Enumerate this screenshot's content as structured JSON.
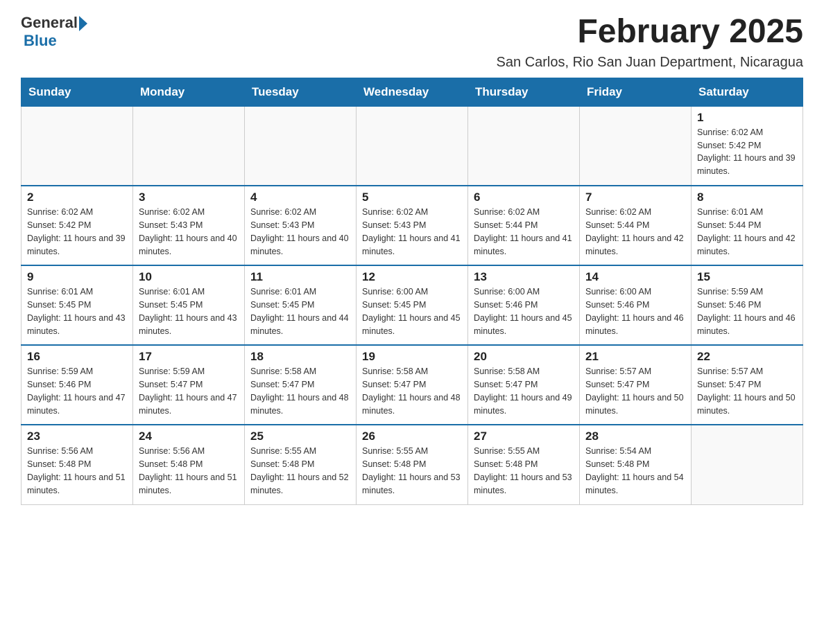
{
  "header": {
    "logo_general": "General",
    "logo_blue": "Blue",
    "month_title": "February 2025",
    "location": "San Carlos, Rio San Juan Department, Nicaragua"
  },
  "days_of_week": [
    "Sunday",
    "Monday",
    "Tuesday",
    "Wednesday",
    "Thursday",
    "Friday",
    "Saturday"
  ],
  "weeks": [
    [
      {
        "day": "",
        "info": ""
      },
      {
        "day": "",
        "info": ""
      },
      {
        "day": "",
        "info": ""
      },
      {
        "day": "",
        "info": ""
      },
      {
        "day": "",
        "info": ""
      },
      {
        "day": "",
        "info": ""
      },
      {
        "day": "1",
        "info": "Sunrise: 6:02 AM\nSunset: 5:42 PM\nDaylight: 11 hours and 39 minutes."
      }
    ],
    [
      {
        "day": "2",
        "info": "Sunrise: 6:02 AM\nSunset: 5:42 PM\nDaylight: 11 hours and 39 minutes."
      },
      {
        "day": "3",
        "info": "Sunrise: 6:02 AM\nSunset: 5:43 PM\nDaylight: 11 hours and 40 minutes."
      },
      {
        "day": "4",
        "info": "Sunrise: 6:02 AM\nSunset: 5:43 PM\nDaylight: 11 hours and 40 minutes."
      },
      {
        "day": "5",
        "info": "Sunrise: 6:02 AM\nSunset: 5:43 PM\nDaylight: 11 hours and 41 minutes."
      },
      {
        "day": "6",
        "info": "Sunrise: 6:02 AM\nSunset: 5:44 PM\nDaylight: 11 hours and 41 minutes."
      },
      {
        "day": "7",
        "info": "Sunrise: 6:02 AM\nSunset: 5:44 PM\nDaylight: 11 hours and 42 minutes."
      },
      {
        "day": "8",
        "info": "Sunrise: 6:01 AM\nSunset: 5:44 PM\nDaylight: 11 hours and 42 minutes."
      }
    ],
    [
      {
        "day": "9",
        "info": "Sunrise: 6:01 AM\nSunset: 5:45 PM\nDaylight: 11 hours and 43 minutes."
      },
      {
        "day": "10",
        "info": "Sunrise: 6:01 AM\nSunset: 5:45 PM\nDaylight: 11 hours and 43 minutes."
      },
      {
        "day": "11",
        "info": "Sunrise: 6:01 AM\nSunset: 5:45 PM\nDaylight: 11 hours and 44 minutes."
      },
      {
        "day": "12",
        "info": "Sunrise: 6:00 AM\nSunset: 5:45 PM\nDaylight: 11 hours and 45 minutes."
      },
      {
        "day": "13",
        "info": "Sunrise: 6:00 AM\nSunset: 5:46 PM\nDaylight: 11 hours and 45 minutes."
      },
      {
        "day": "14",
        "info": "Sunrise: 6:00 AM\nSunset: 5:46 PM\nDaylight: 11 hours and 46 minutes."
      },
      {
        "day": "15",
        "info": "Sunrise: 5:59 AM\nSunset: 5:46 PM\nDaylight: 11 hours and 46 minutes."
      }
    ],
    [
      {
        "day": "16",
        "info": "Sunrise: 5:59 AM\nSunset: 5:46 PM\nDaylight: 11 hours and 47 minutes."
      },
      {
        "day": "17",
        "info": "Sunrise: 5:59 AM\nSunset: 5:47 PM\nDaylight: 11 hours and 47 minutes."
      },
      {
        "day": "18",
        "info": "Sunrise: 5:58 AM\nSunset: 5:47 PM\nDaylight: 11 hours and 48 minutes."
      },
      {
        "day": "19",
        "info": "Sunrise: 5:58 AM\nSunset: 5:47 PM\nDaylight: 11 hours and 48 minutes."
      },
      {
        "day": "20",
        "info": "Sunrise: 5:58 AM\nSunset: 5:47 PM\nDaylight: 11 hours and 49 minutes."
      },
      {
        "day": "21",
        "info": "Sunrise: 5:57 AM\nSunset: 5:47 PM\nDaylight: 11 hours and 50 minutes."
      },
      {
        "day": "22",
        "info": "Sunrise: 5:57 AM\nSunset: 5:47 PM\nDaylight: 11 hours and 50 minutes."
      }
    ],
    [
      {
        "day": "23",
        "info": "Sunrise: 5:56 AM\nSunset: 5:48 PM\nDaylight: 11 hours and 51 minutes."
      },
      {
        "day": "24",
        "info": "Sunrise: 5:56 AM\nSunset: 5:48 PM\nDaylight: 11 hours and 51 minutes."
      },
      {
        "day": "25",
        "info": "Sunrise: 5:55 AM\nSunset: 5:48 PM\nDaylight: 11 hours and 52 minutes."
      },
      {
        "day": "26",
        "info": "Sunrise: 5:55 AM\nSunset: 5:48 PM\nDaylight: 11 hours and 53 minutes."
      },
      {
        "day": "27",
        "info": "Sunrise: 5:55 AM\nSunset: 5:48 PM\nDaylight: 11 hours and 53 minutes."
      },
      {
        "day": "28",
        "info": "Sunrise: 5:54 AM\nSunset: 5:48 PM\nDaylight: 11 hours and 54 minutes."
      },
      {
        "day": "",
        "info": ""
      }
    ]
  ]
}
